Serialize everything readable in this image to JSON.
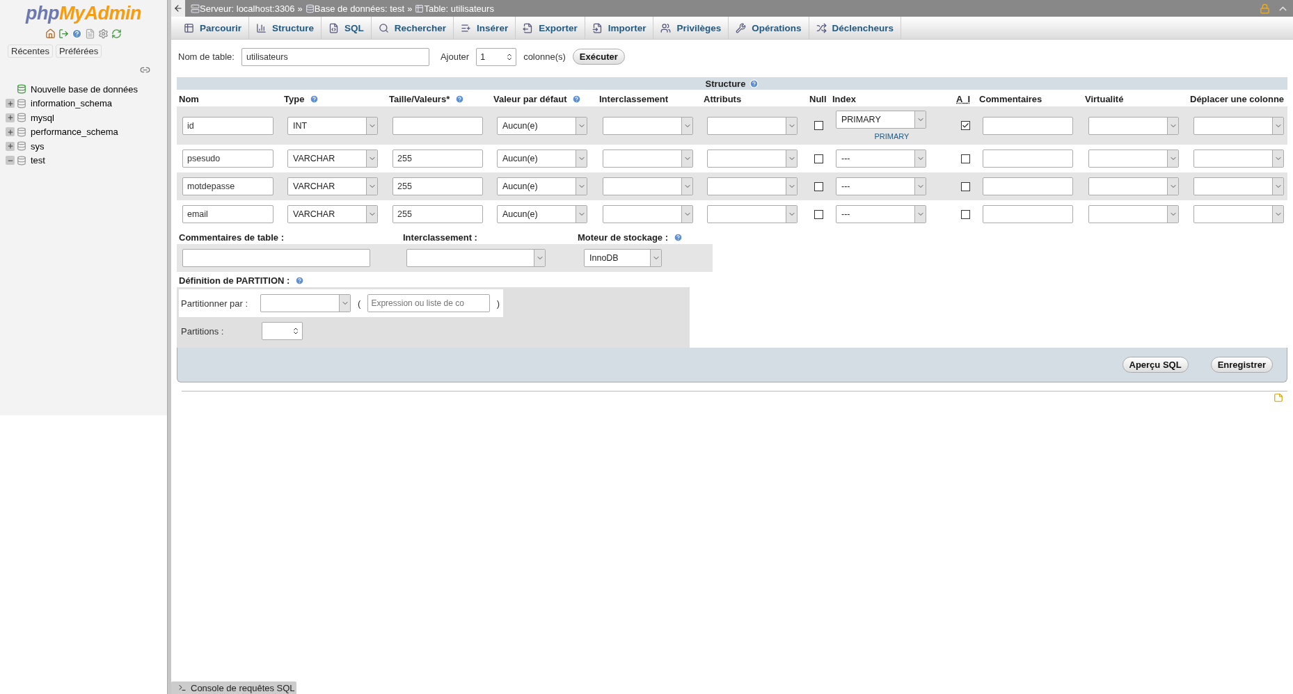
{
  "sidebar": {
    "logo": {
      "first": "php",
      "second": "MyAdmin"
    },
    "buttons": [
      {
        "label": "Récentes"
      },
      {
        "label": "Préférées"
      }
    ],
    "tree": [
      {
        "label": "Nouvelle base de données",
        "kind": "new"
      },
      {
        "label": "information_schema",
        "kind": "db",
        "expanded": false
      },
      {
        "label": "mysql",
        "kind": "db",
        "expanded": false
      },
      {
        "label": "performance_schema",
        "kind": "db",
        "expanded": false
      },
      {
        "label": "sys",
        "kind": "db",
        "expanded": false
      },
      {
        "label": "test",
        "kind": "db",
        "expanded": true
      }
    ]
  },
  "breadcrumb": {
    "separator": "»",
    "items": [
      {
        "label": "Serveur: localhost:3306",
        "kind": "server"
      },
      {
        "label": "Base de données: test",
        "kind": "database"
      },
      {
        "label": "Table: utilisateurs",
        "kind": "table"
      }
    ]
  },
  "tabs": [
    {
      "label": "Parcourir",
      "kind": "browse"
    },
    {
      "label": "Structure",
      "kind": "structure"
    },
    {
      "label": "SQL",
      "kind": "sql"
    },
    {
      "label": "Rechercher",
      "kind": "search"
    },
    {
      "label": "Insérer",
      "kind": "insert"
    },
    {
      "label": "Exporter",
      "kind": "export"
    },
    {
      "label": "Importer",
      "kind": "import"
    },
    {
      "label": "Privilèges",
      "kind": "privileges"
    },
    {
      "label": "Opérations",
      "kind": "operations"
    },
    {
      "label": "Déclencheurs",
      "kind": "triggers"
    }
  ],
  "table_form": {
    "name_label": "Nom de table:",
    "name_value": "utilisateurs",
    "add_label": "Ajouter",
    "add_value": "1",
    "add_suffix": "colonne(s)",
    "execute": "Exécuter"
  },
  "structure": {
    "title": "Structure",
    "columns": [
      {
        "label": "Nom",
        "help": false
      },
      {
        "label": "Type",
        "help": true
      },
      {
        "label": "Taille/Valeurs*",
        "help": true
      },
      {
        "label": "Valeur par défaut",
        "help": true
      },
      {
        "label": "Interclassement",
        "help": false
      },
      {
        "label": "Attributs",
        "help": false
      },
      {
        "label": "Null",
        "help": false
      },
      {
        "label": "Index",
        "help": false
      },
      {
        "label": "A_I",
        "help": false
      },
      {
        "label": "Commentaires",
        "help": false
      },
      {
        "label": "Virtualité",
        "help": false
      },
      {
        "label": "Déplacer une colonne",
        "help": false
      }
    ],
    "rows": [
      {
        "name": "id",
        "type": "INT",
        "length": "",
        "default": "Aucun(e)",
        "null": false,
        "index": "PRIMARY",
        "index_note": "PRIMARY",
        "ai": true
      },
      {
        "name": "psesudo",
        "type": "VARCHAR",
        "length": "255",
        "default": "Aucun(e)",
        "null": false,
        "index": "---",
        "ai": false
      },
      {
        "name": "motdepasse",
        "type": "VARCHAR",
        "length": "255",
        "default": "Aucun(e)",
        "null": false,
        "index": "---",
        "ai": false
      },
      {
        "name": "email",
        "type": "VARCHAR",
        "length": "255",
        "default": "Aucun(e)",
        "null": false,
        "index": "---",
        "ai": false
      }
    ]
  },
  "table_options": {
    "comments_label": "Commentaires de table :",
    "collation_label": "Interclassement :",
    "engine_label": "Moteur de stockage :",
    "engine_value": "InnoDB"
  },
  "partition": {
    "title": "Définition de PARTITION :",
    "by_label": "Partitionner par :",
    "open": "(",
    "expression_placeholder": "Expression ou liste de co",
    "close": ")",
    "count_label": "Partitions :"
  },
  "footer_buttons": [
    {
      "label": "Aperçu SQL"
    },
    {
      "label": "Enregistrer"
    }
  ],
  "console": {
    "label": "Console de requêtes SQL"
  }
}
